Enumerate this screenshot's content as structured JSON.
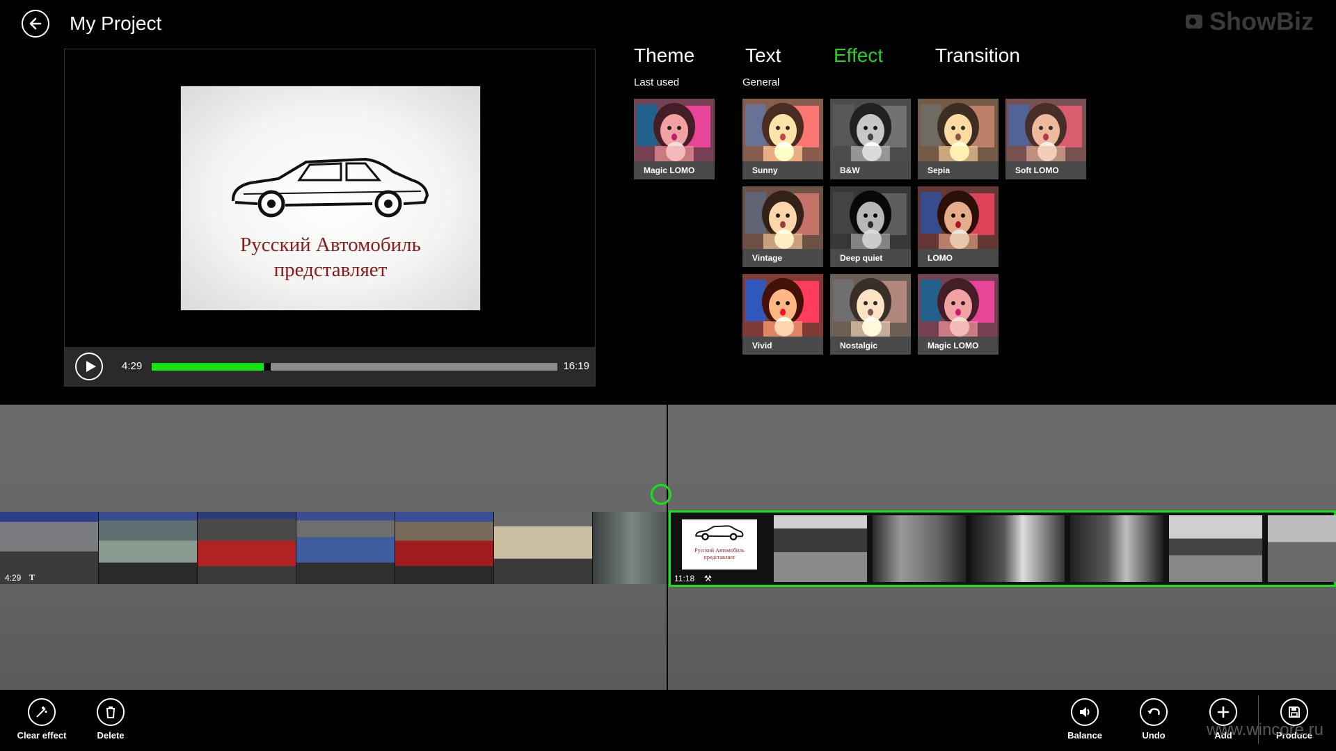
{
  "header": {
    "title": "My Project",
    "watermark": "ShowBiz"
  },
  "player": {
    "preview_caption_line1": "Русский Автомобиль",
    "preview_caption_line2": "представляет",
    "current_time": "4:29",
    "total_time": "16:19",
    "progress_fraction": 0.28
  },
  "tabs": [
    {
      "label": "Theme",
      "active": false
    },
    {
      "label": "Text",
      "active": false
    },
    {
      "label": "Effect",
      "active": true
    },
    {
      "label": "Transition",
      "active": false
    }
  ],
  "sections": {
    "last_used": "Last used",
    "general": "General"
  },
  "effects": {
    "last_used": [
      {
        "label": "Magic LOMO",
        "style": "magic"
      }
    ],
    "general": [
      {
        "label": "Sunny",
        "style": "sunny"
      },
      {
        "label": "B&W",
        "style": "bw"
      },
      {
        "label": "Sepia",
        "style": "sepia"
      },
      {
        "label": "Soft LOMO",
        "style": "softlomo"
      },
      {
        "label": "Vintage",
        "style": "vintage"
      },
      {
        "label": "Deep quiet",
        "style": "deepquiet"
      },
      {
        "label": "LOMO",
        "style": "lomo"
      },
      {
        "label": "Vivid",
        "style": "vivid"
      },
      {
        "label": "Nostalgic",
        "style": "nostalgic"
      },
      {
        "label": "Magic LOMO",
        "style": "magic"
      }
    ]
  },
  "timeline": {
    "left_clip": {
      "duration": "4:29",
      "badge": "T"
    },
    "right_clip": {
      "duration": "11:18",
      "title_card_line1": "Русский Автомобиль",
      "title_card_line2": "представляет"
    }
  },
  "appbar": {
    "clear_effect": "Clear effect",
    "delete": "Delete",
    "balance": "Balance",
    "undo": "Undo",
    "add": "Add",
    "produce": "Produce"
  },
  "watermark_bottom": "www.wincore.ru",
  "colors": {
    "accent": "#14e314",
    "background": "#000000",
    "timeline": "#666666"
  }
}
